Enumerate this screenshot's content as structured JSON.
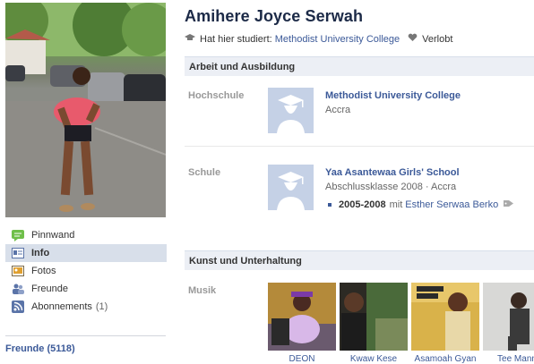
{
  "profile": {
    "name": "Amihere Joyce Serwah",
    "studies_prefix": "Hat hier studiert:",
    "studies_school": "Methodist University College",
    "relationship": "Verlobt"
  },
  "nav": {
    "items": [
      {
        "label": "Pinnwand",
        "icon": "wall-icon"
      },
      {
        "label": "Info",
        "icon": "info-icon",
        "active": true
      },
      {
        "label": "Fotos",
        "icon": "photos-icon"
      },
      {
        "label": "Freunde",
        "icon": "friends-icon"
      },
      {
        "label": "Abonnements",
        "icon": "subscriptions-icon",
        "count": "(1)"
      }
    ],
    "friends_heading": "Freunde (5118)"
  },
  "work_education": {
    "heading": "Arbeit und Ausbildung",
    "college": {
      "label": "Hochschule",
      "name": "Methodist University College",
      "location": "Accra"
    },
    "school": {
      "label": "Schule",
      "name": "Yaa Asantewaa Girls' School",
      "meta": "Abschlussklasse 2008 · Accra",
      "years": "2005-2008",
      "with_prefix": "mit",
      "with_person": "Esther Serwaa Berko"
    }
  },
  "arts": {
    "heading": "Kunst und Unterhaltung",
    "music_label": "Musik",
    "music_items": [
      {
        "name": "DEON"
      },
      {
        "name": "Kwaw Kese"
      },
      {
        "name": "Asamoah Gyan"
      },
      {
        "name": "Tee Mann"
      }
    ]
  },
  "colors": {
    "link": "#3b5998",
    "section_bg": "#eceff5",
    "nav_active": "#d8dfea",
    "placeholder_bg": "#c5d1e6"
  }
}
